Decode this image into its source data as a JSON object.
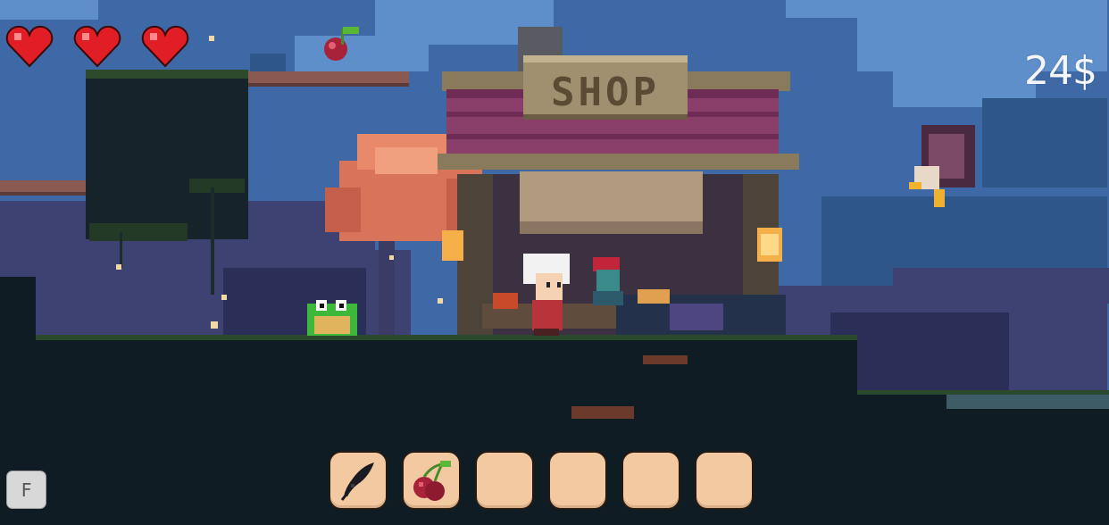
{
  "hud": {
    "hearts": [
      {
        "state": "full"
      },
      {
        "state": "full"
      },
      {
        "state": "full"
      }
    ],
    "money": "24$"
  },
  "world": {
    "shop_sign": "SHOP",
    "collectible": "cherry-icon",
    "characters": [
      "player-white-hair",
      "frog-enemy",
      "shopkeeper",
      "eagle-enemy"
    ]
  },
  "hotbar": {
    "slots": [
      {
        "item": "feather-icon"
      },
      {
        "item": "cherry-icon"
      },
      {
        "item": "empty"
      },
      {
        "item": "empty"
      },
      {
        "item": "empty"
      },
      {
        "item": "empty"
      }
    ]
  },
  "controls": {
    "interact_key": "F"
  },
  "colors": {
    "sky": "#3f69a6",
    "heart": "#e11d26",
    "slot": "#f2c9a1",
    "money_text": "#f4f6fa"
  }
}
